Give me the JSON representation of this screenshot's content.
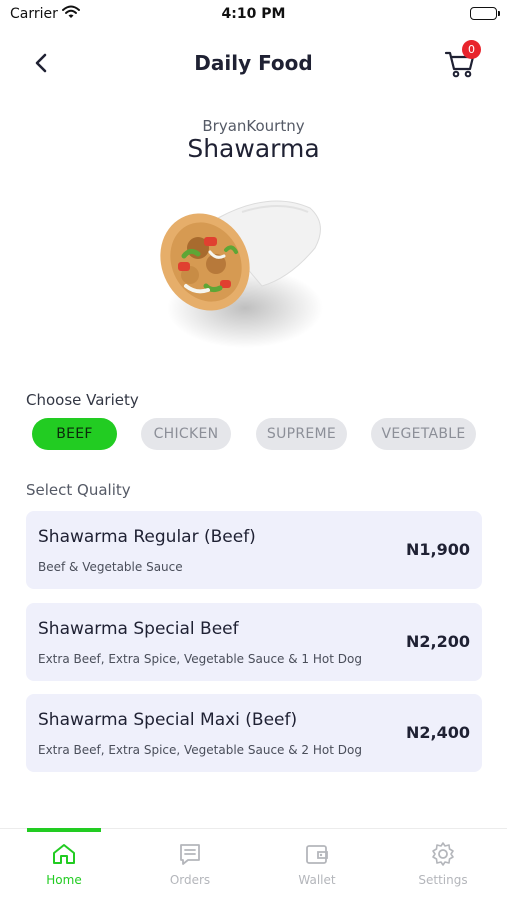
{
  "status_bar": {
    "carrier": "Carrier",
    "time": "4:10 PM"
  },
  "header": {
    "title": "Daily Food",
    "cart_count": "0"
  },
  "product": {
    "vendor": "BryanKourtny",
    "name": "Shawarma"
  },
  "variety": {
    "label": "Choose Variety",
    "options": [
      "BEEF",
      "CHICKEN",
      "SUPREME",
      "VEGETABLE"
    ],
    "selected": "BEEF"
  },
  "quality": {
    "label": "Select Quality",
    "options": [
      {
        "title": "Shawarma Regular (Beef)",
        "description": "Beef & Vegetable Sauce",
        "price": "N1,900"
      },
      {
        "title": "Shawarma Special Beef",
        "description": "Extra Beef, Extra Spice, Vegetable Sauce & 1 Hot Dog",
        "price": "N2,200"
      },
      {
        "title": "Shawarma Special Maxi (Beef)",
        "description": "Extra Beef, Extra Spice, Vegetable Sauce & 2 Hot Dog",
        "price": "N2,400"
      }
    ]
  },
  "tabs": [
    {
      "label": "Home",
      "icon": "home-icon",
      "active": true
    },
    {
      "label": "Orders",
      "icon": "orders-icon",
      "active": false
    },
    {
      "label": "Wallet",
      "icon": "wallet-icon",
      "active": false
    },
    {
      "label": "Settings",
      "icon": "gear-icon",
      "active": false
    }
  ],
  "colors": {
    "accent": "#22cc22",
    "badge": "#e8242c",
    "card": "#eff0fb",
    "chip": "#e5e6ea"
  }
}
